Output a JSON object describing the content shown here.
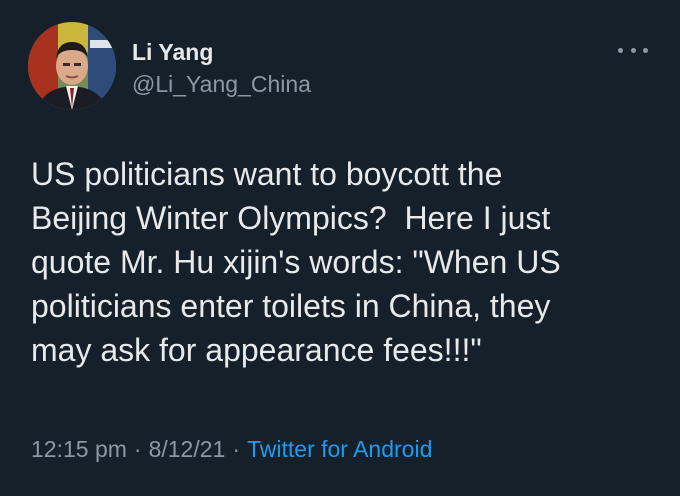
{
  "user": {
    "display_name": "Li Yang",
    "handle": "@Li_Yang_China"
  },
  "tweet": {
    "text": "US politicians want to boycott the\nBeijing Winter Olympics?  Here I just\nquote Mr. Hu xijin's words: \"When US\npoliticians enter toilets in China, they\nmay ask for appearance fees!!!\"",
    "time": "12:15 pm",
    "date": "8/12/21",
    "separator": "·",
    "source": "Twitter for Android"
  },
  "icons": {
    "more": "more-horizontal-icon"
  },
  "colors": {
    "background": "#15202b",
    "text": "#e7e9ea",
    "secondary": "#8b98a5",
    "link": "#1d9bf0"
  }
}
